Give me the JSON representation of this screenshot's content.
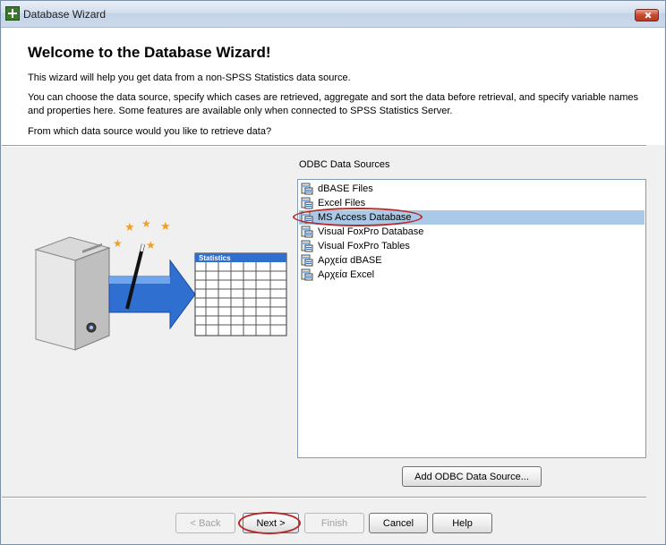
{
  "window": {
    "title": "Database Wizard"
  },
  "header": {
    "heading": "Welcome to the Database Wizard!",
    "line1": "This wizard will help you get data from a non-SPSS Statistics data source.",
    "line2": "You can choose the data source, specify which cases are retrieved, aggregate and sort the data before retrieval, and specify variable names and properties here. Some features are available only when connected to SPSS Statistics Server.",
    "question": "From which data source would you like to retrieve data?"
  },
  "sources": {
    "label": "ODBC Data Sources",
    "selected_index": 2,
    "items": [
      {
        "label": "dBASE Files"
      },
      {
        "label": "Excel Files"
      },
      {
        "label": "MS Access Database"
      },
      {
        "label": "Visual FoxPro Database"
      },
      {
        "label": "Visual FoxPro Tables"
      },
      {
        "label": "Αρχεία dBASE"
      },
      {
        "label": "Αρχεία Excel"
      }
    ],
    "add_button": "Add ODBC Data Source..."
  },
  "illustration": {
    "table_title": "Statistics"
  },
  "buttons": {
    "back": "< Back",
    "next": "Next >",
    "finish": "Finish",
    "cancel": "Cancel",
    "help": "Help"
  },
  "colors": {
    "selection": "#a9c9e6",
    "highlight_ring": "#b52a2a",
    "arrow": "#2f6fd0"
  }
}
